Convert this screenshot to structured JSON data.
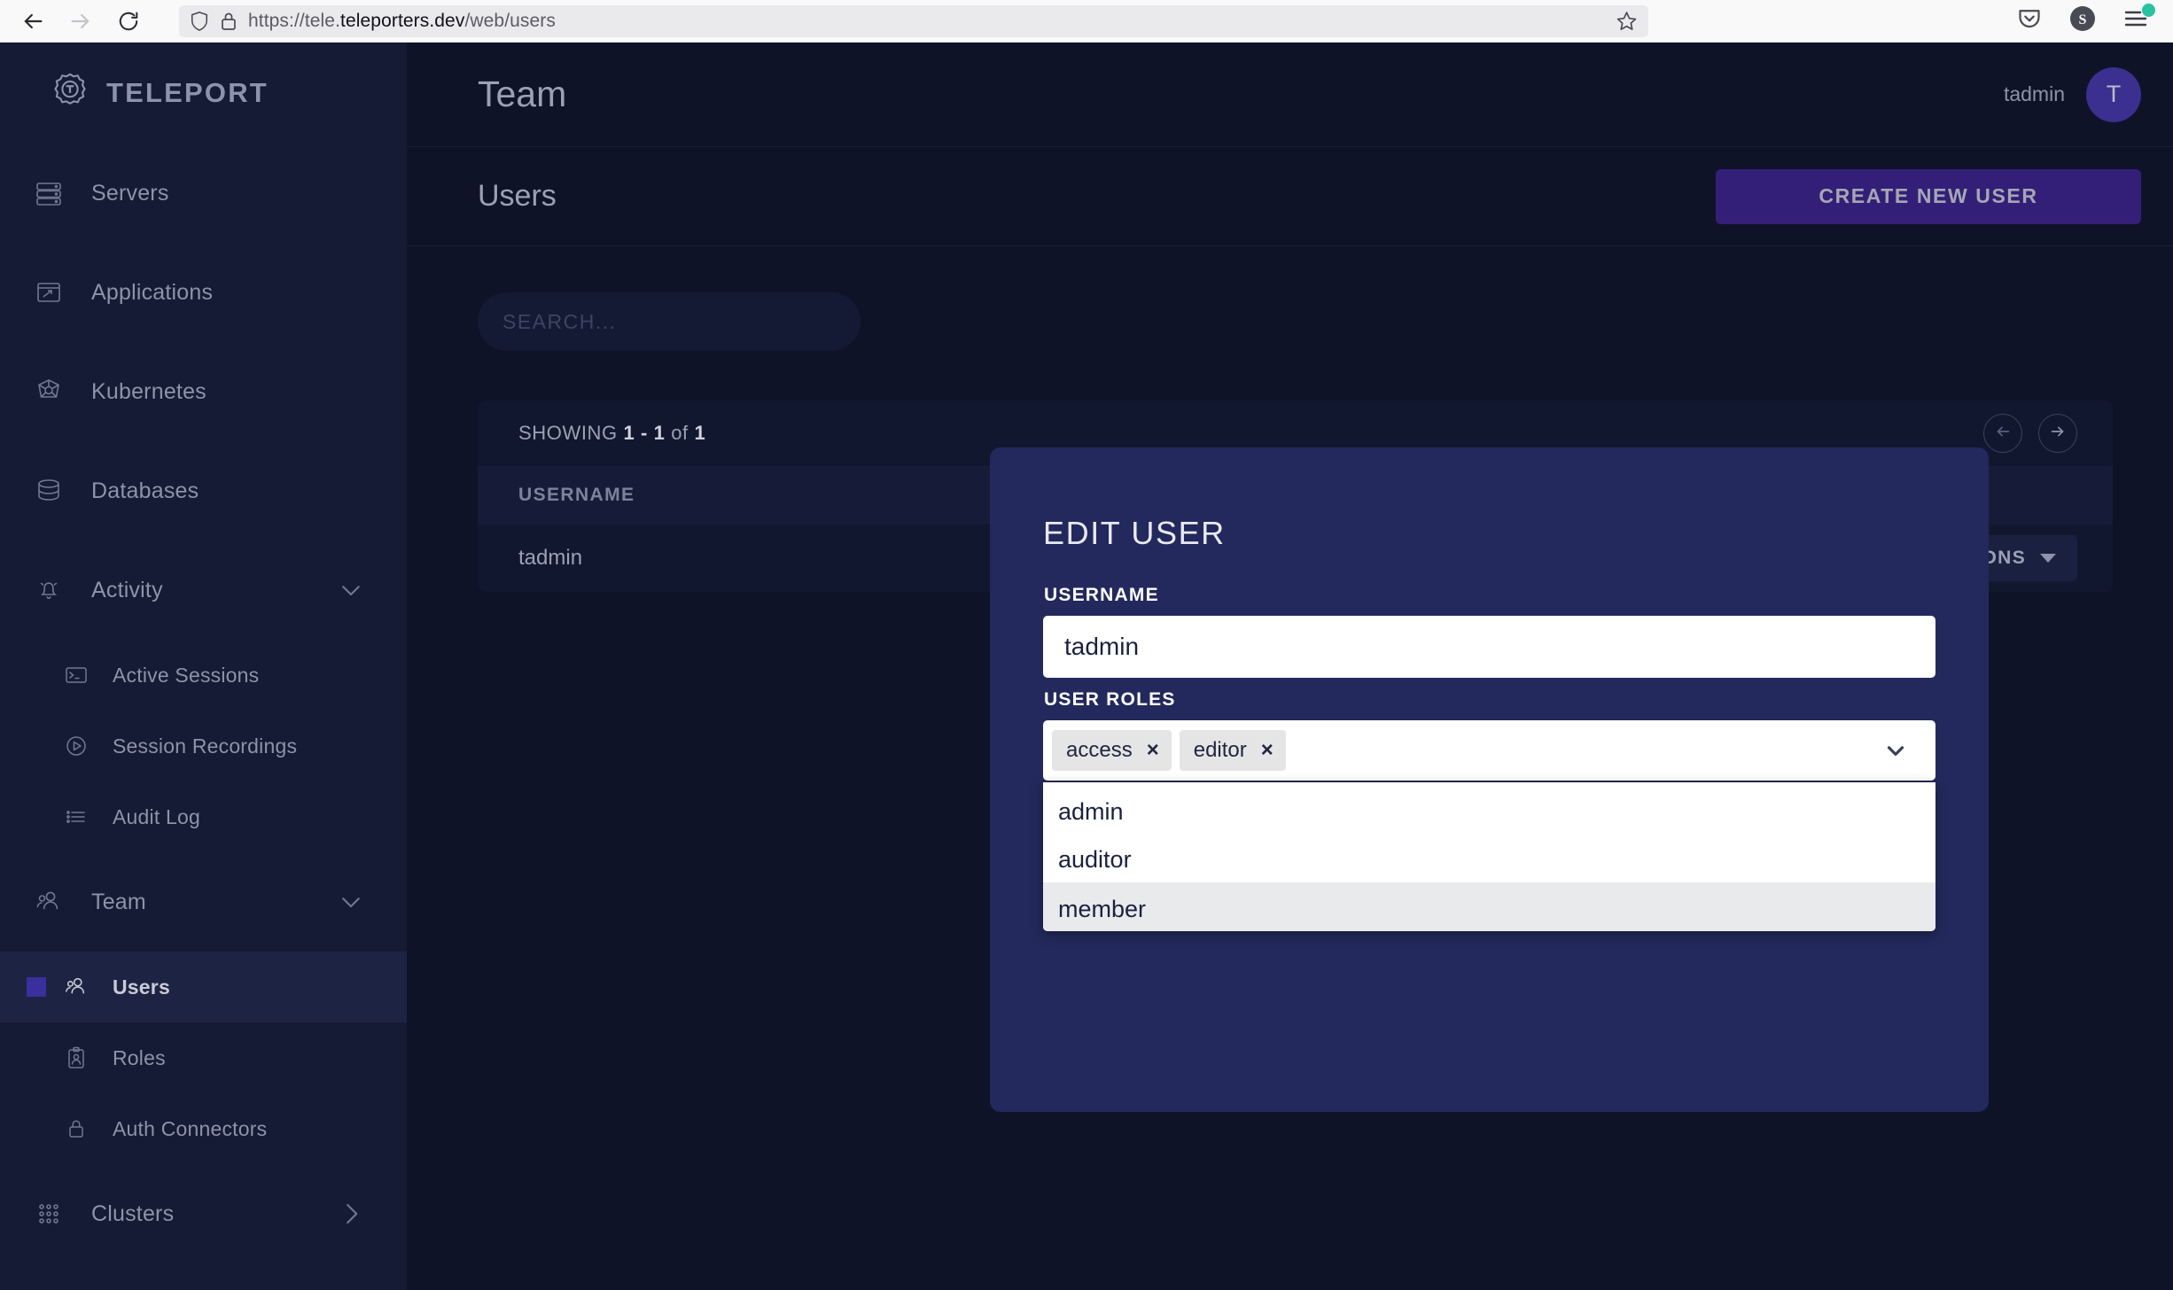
{
  "browser": {
    "url_prefix": "https://tele.",
    "url_host": "teleporters.dev",
    "url_path": "/web/users",
    "icons": {
      "back": "back-arrow-icon",
      "forward": "forward-arrow-icon",
      "reload": "reload-icon",
      "shield": "shield-icon",
      "lock": "lock-icon",
      "bookmark": "star-icon",
      "pocket": "pocket-icon",
      "account": "account-avatar-icon",
      "menu": "hamburger-menu-icon"
    },
    "badge_color": "#2ac3a0"
  },
  "sidebar": {
    "brand": "TELEPORT",
    "items": [
      {
        "label": "Servers",
        "icon": "server-icon",
        "level": 1
      },
      {
        "label": "Applications",
        "icon": "applications-icon",
        "level": 1
      },
      {
        "label": "Kubernetes",
        "icon": "kubernetes-icon",
        "level": 1
      },
      {
        "label": "Databases",
        "icon": "database-icon",
        "level": 1
      },
      {
        "label": "Activity",
        "icon": "bell-icon",
        "level": 1,
        "chevron": "chevron-down-icon"
      },
      {
        "label": "Active Sessions",
        "icon": "terminal-icon",
        "level": 2
      },
      {
        "label": "Session Recordings",
        "icon": "play-circle-icon",
        "level": 2
      },
      {
        "label": "Audit Log",
        "icon": "list-icon",
        "level": 2
      },
      {
        "label": "Team",
        "icon": "team-icon",
        "level": 1,
        "chevron": "chevron-down-icon"
      },
      {
        "label": "Users",
        "icon": "users-icon",
        "level": 2,
        "active": true
      },
      {
        "label": "Roles",
        "icon": "roles-badge-icon",
        "level": 2
      },
      {
        "label": "Auth Connectors",
        "icon": "lock-icon",
        "level": 2
      },
      {
        "label": "Clusters",
        "icon": "grid-icon",
        "level": 1,
        "chevron": "chevron-right-icon"
      }
    ]
  },
  "topbar": {
    "title": "Team",
    "username": "tadmin",
    "avatar_initial": "T"
  },
  "subbar": {
    "title": "Users",
    "create_button": "CREATE NEW USER"
  },
  "search": {
    "value": "",
    "placeholder": "SEARCH..."
  },
  "table": {
    "showing_prefix": "SHOWING ",
    "showing_range": "1 - 1",
    "showing_middle": " of ",
    "showing_total": "1",
    "prev_icon": "arrow-left-circle-icon",
    "next_icon": "arrow-right-circle-icon",
    "columns": [
      "USERNAME"
    ],
    "rows": [
      {
        "username": "tadmin",
        "options_label": "OPTIONS"
      }
    ]
  },
  "modal": {
    "title": "EDIT USER",
    "username_label": "USERNAME",
    "username_value": "tadmin",
    "roles_label": "USER ROLES",
    "selected_roles": [
      "access",
      "editor"
    ],
    "remove_glyph": "×",
    "chevron_icon": "chevron-down-icon",
    "dropdown_options": [
      "admin",
      "auditor",
      "member"
    ],
    "highlighted_option": "member"
  },
  "colors": {
    "accent_purple": "#341f78",
    "sidebar_bg": "#151a35",
    "page_bg": "#0f1327",
    "modal_bg": "#23295c"
  }
}
